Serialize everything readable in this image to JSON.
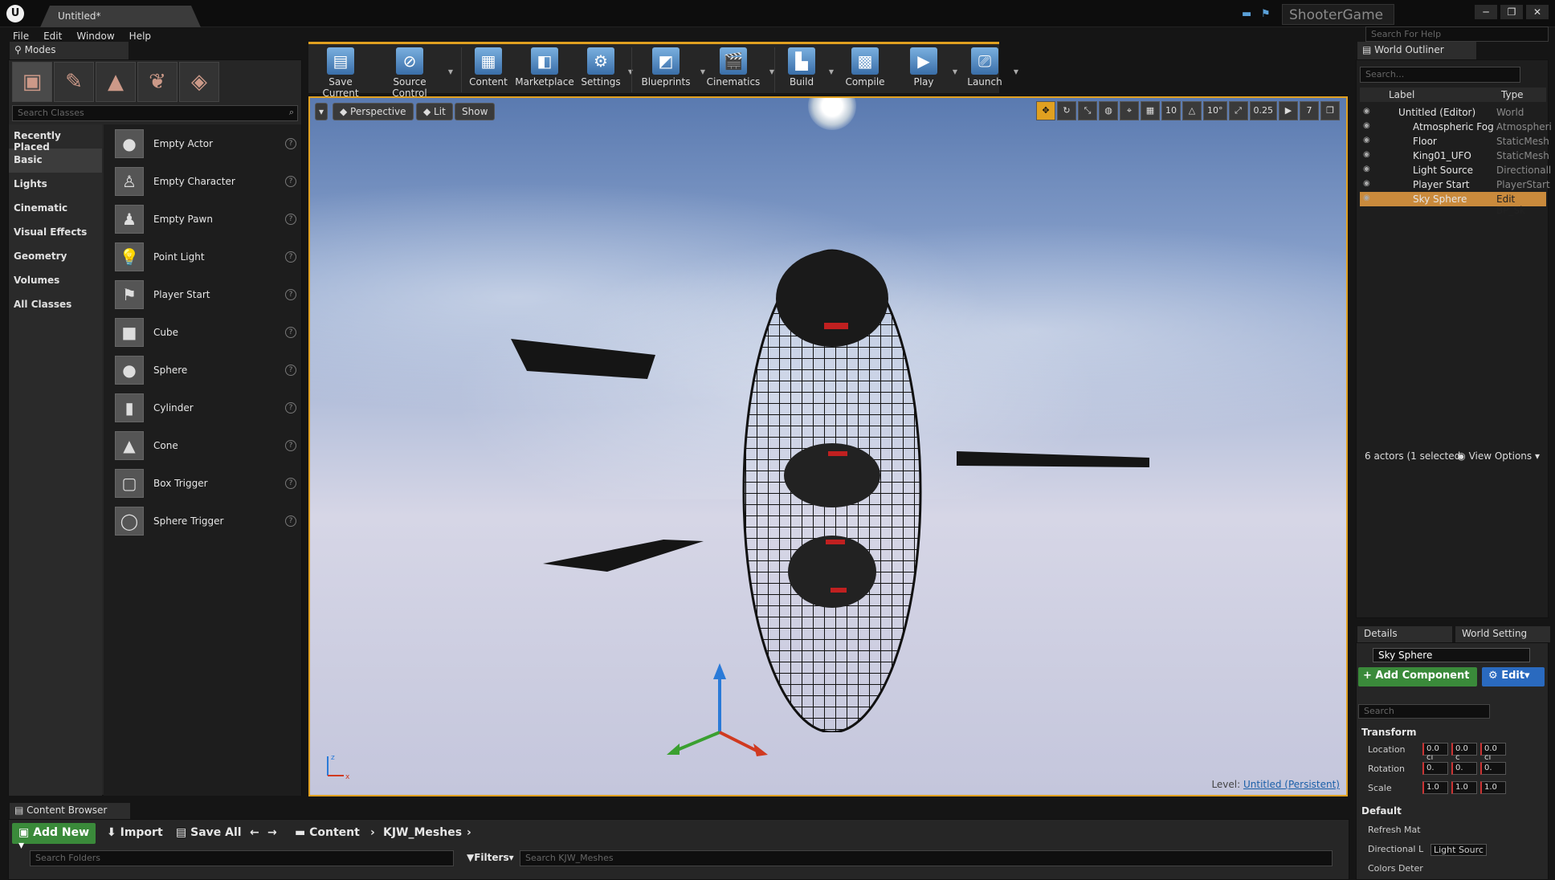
{
  "window": {
    "tab_title": "Untitled*",
    "brand": "ShooterGame",
    "help_placeholder": "Search For Help"
  },
  "menu": [
    "File",
    "Edit",
    "Window",
    "Help"
  ],
  "modes": {
    "tab": "Modes",
    "search_placeholder": "Search Classes",
    "categories": [
      "Recently Placed",
      "Basic",
      "Lights",
      "Cinematic",
      "Visual Effects",
      "Geometry",
      "Volumes",
      "All Classes"
    ],
    "classes": [
      "Empty Actor",
      "Empty Character",
      "Empty Pawn",
      "Point Light",
      "Player Start",
      "Cube",
      "Sphere",
      "Cylinder",
      "Cone",
      "Box Trigger",
      "Sphere Trigger"
    ]
  },
  "toolbar": {
    "buttons": [
      "Save Current",
      "Source Control",
      "Content",
      "Marketplace",
      "Settings",
      "Blueprints",
      "Cinematics",
      "Build",
      "Compile",
      "Play",
      "Launch"
    ]
  },
  "viewport": {
    "perspective": "Perspective",
    "lit": "Lit",
    "show": "Show",
    "grid_snap": "10",
    "rot_snap": "10°",
    "scale_snap": "0.25",
    "cam_speed": "7",
    "level_prefix": "Level:",
    "level_name": "Untitled (Persistent)"
  },
  "outliner": {
    "tab": "World Outliner",
    "search_placeholder": "Search...",
    "col_label": "Label",
    "col_type": "Type",
    "rows": [
      {
        "label": "Untitled (Editor)",
        "type": "World"
      },
      {
        "label": "Atmospheric Fog",
        "type": "Atmospheri"
      },
      {
        "label": "Floor",
        "type": "StaticMesh"
      },
      {
        "label": "King01_UFO",
        "type": "StaticMesh"
      },
      {
        "label": "Light Source",
        "type": "Directionall"
      },
      {
        "label": "Player Start",
        "type": "PlayerStart"
      },
      {
        "label": "Sky Sphere",
        "type": "Edit BP_Sk"
      }
    ],
    "status": "6 actors (1 selected",
    "view_options": "View Options"
  },
  "details": {
    "tab_details": "Details",
    "tab_world": "World Setting",
    "name": "Sky Sphere",
    "add_component": "+ Add Component",
    "edit": "Edit",
    "search_placeholder": "Search",
    "transform": "Transform",
    "location": "Location",
    "rotation": "Rotation",
    "scale": "Scale",
    "loc_vals": [
      "0.0 cı",
      "0.0 c",
      "0.0 cı"
    ],
    "rot_vals": [
      "0.",
      "0.",
      "0."
    ],
    "scale_vals": [
      "1.0",
      "1.0",
      "1.0"
    ],
    "default": "Default",
    "refresh": "Refresh Mat",
    "directional": "Directional L",
    "directional_val": "Light Sourc",
    "colors": "Colors Deter"
  },
  "content_browser": {
    "tab": "Content Browser",
    "add_new": "Add New",
    "import": "Import",
    "save_all": "Save All",
    "crumbs": [
      "Content",
      "KJW_Meshes"
    ],
    "folder_placeholder": "Search Folders",
    "filters": "Filters",
    "asset_placeholder": "Search KJW_Meshes"
  }
}
